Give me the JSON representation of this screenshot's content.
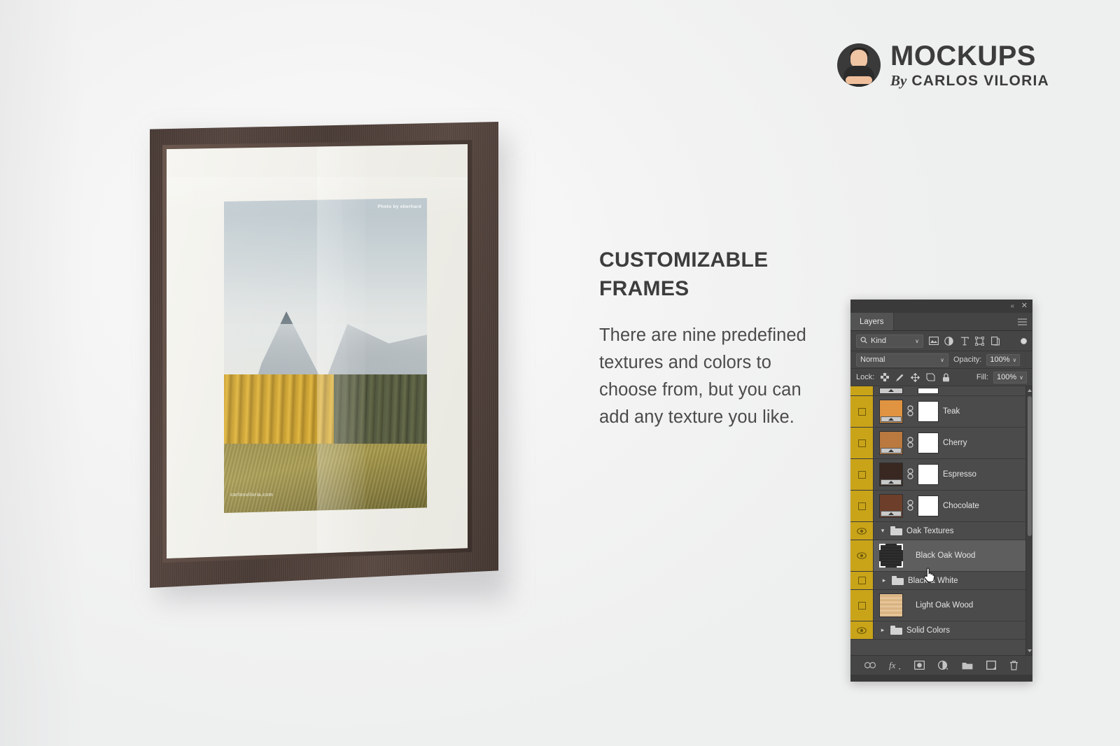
{
  "brand": {
    "title": "MOCKUPS",
    "by": "By",
    "author": "CARLOS VILORIA",
    "avatar_icon": "person-avatar-icon"
  },
  "copy": {
    "headline": "CUSTOMIZABLE FRAMES",
    "body": "There are nine predefined textures and colors to choose from, but you can add any texture you like."
  },
  "artwork": {
    "credit": "Photo by eberhard",
    "watermark": "carlosviloria.com",
    "frame_color": "#4b3c36",
    "mat_color": "#f2f1ea"
  },
  "panel": {
    "titlebar": {
      "collapse_label": "«",
      "close_label": "✕"
    },
    "tab": "Layers",
    "filter": {
      "kind_label": "Kind",
      "search_icon": "search-icon",
      "caret": "∨",
      "icons": [
        "pixel-layer-filter-icon",
        "adjustment-layer-filter-icon",
        "type-layer-filter-icon",
        "shape-layer-filter-icon",
        "smart-object-filter-icon"
      ]
    },
    "blend": {
      "mode": "Normal",
      "opacity_label": "Opacity:",
      "opacity_value": "100%"
    },
    "lock": {
      "label": "Lock:",
      "icons": [
        "lock-transparent-pixels-icon",
        "lock-image-pixels-icon",
        "lock-position-icon",
        "lock-artboard-nesting-icon",
        "lock-all-icon"
      ],
      "fill_label": "Fill:",
      "fill_value": "100%"
    },
    "layers": [
      {
        "name": "",
        "type": "clipped-partial",
        "visible": true,
        "selected": false,
        "thumb": "#b8b8b8",
        "has_mask": true,
        "has_link": false,
        "indent": 0
      },
      {
        "name": "Teak",
        "type": "layer",
        "visible": false,
        "selected": false,
        "thumb": "#e09340",
        "has_mask": true,
        "has_link": true,
        "indent": 0
      },
      {
        "name": "Cherry",
        "type": "layer",
        "visible": false,
        "selected": false,
        "thumb": "#b9793f",
        "has_mask": true,
        "has_link": true,
        "indent": 0
      },
      {
        "name": "Espresso",
        "type": "layer",
        "visible": false,
        "selected": false,
        "thumb": "#392821",
        "has_mask": true,
        "has_link": true,
        "indent": 0
      },
      {
        "name": "Chocolate",
        "type": "layer",
        "visible": false,
        "selected": false,
        "thumb": "#6d3f2b",
        "has_mask": true,
        "has_link": true,
        "indent": 0
      },
      {
        "name": "Oak Textures",
        "type": "group-open",
        "visible": true,
        "selected": false,
        "indent": 0
      },
      {
        "name": "Black Oak Wood",
        "type": "layer-nomask",
        "visible": true,
        "selected": true,
        "thumb": "#2b2b2b",
        "indent": 0
      },
      {
        "name": "Black & White",
        "type": "group-closed",
        "visible": false,
        "selected": false,
        "indent": 1
      },
      {
        "name": "Light Oak Wood",
        "type": "layer-nomask",
        "visible": false,
        "selected": false,
        "thumb": "#e0bd8d",
        "indent": 0
      },
      {
        "name": "Solid Colors",
        "type": "group-closed",
        "visible": true,
        "selected": false,
        "indent": 0
      }
    ],
    "footer_icons": [
      "link-layers-icon",
      "layer-style-fx-icon",
      "add-layer-mask-icon",
      "new-adjustment-layer-icon",
      "new-group-icon",
      "new-layer-icon",
      "delete-layer-icon"
    ],
    "accent_color": "#c9a419",
    "panel_bg": "#3f3f3f"
  },
  "cursor": {
    "icon": "pointing-hand-cursor"
  }
}
